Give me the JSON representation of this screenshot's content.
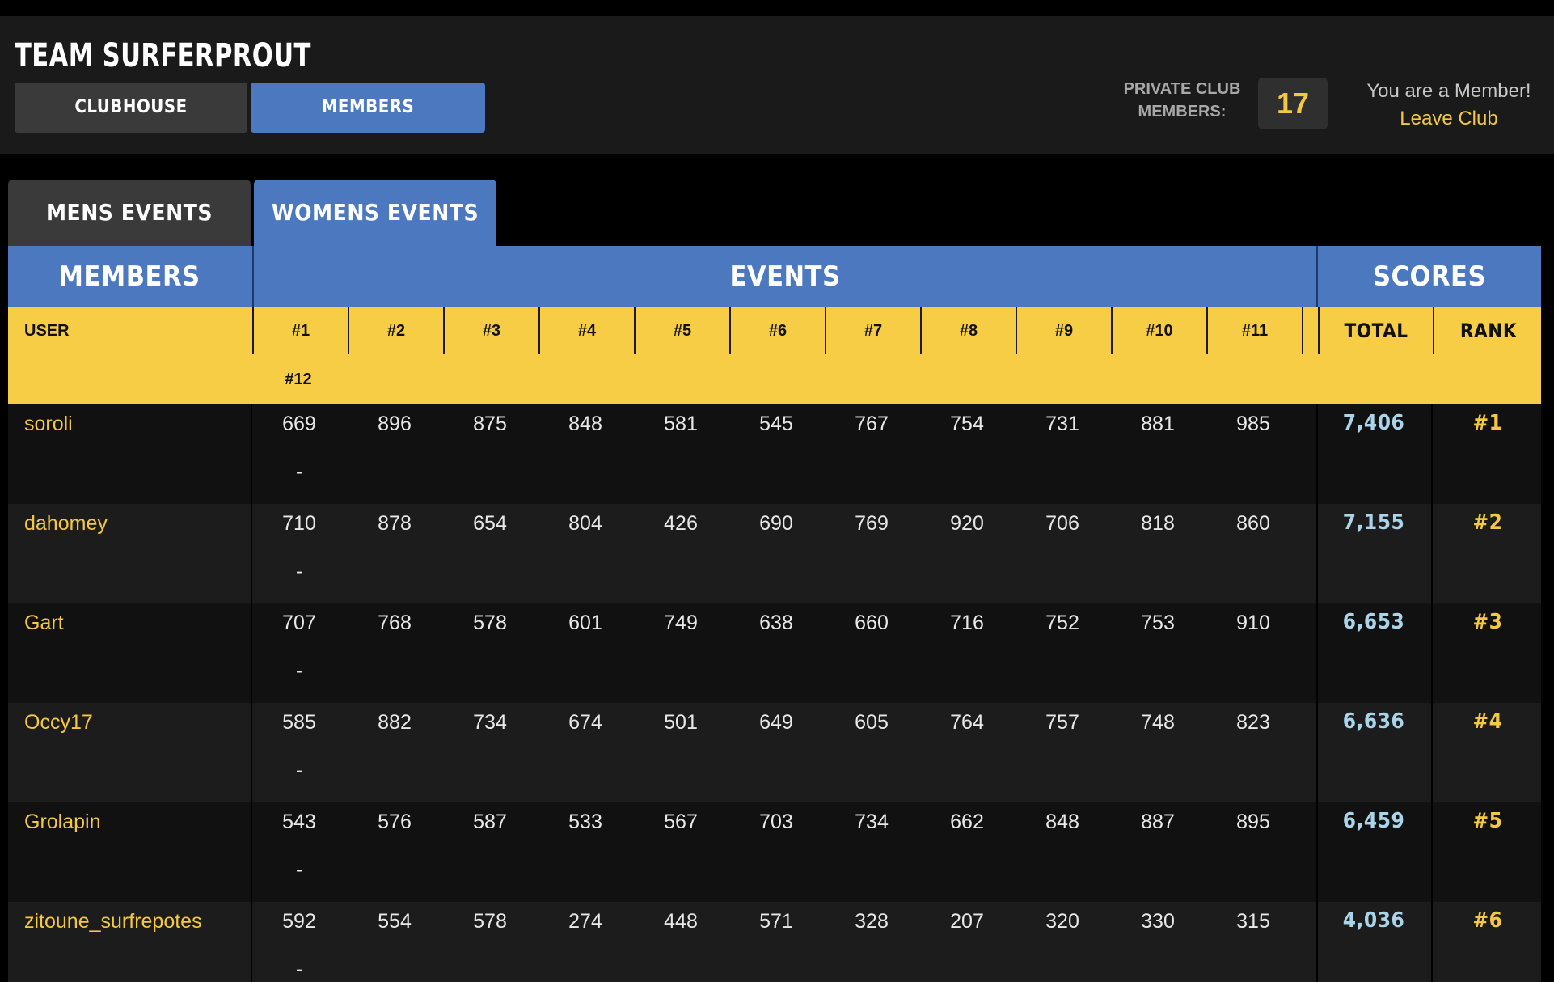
{
  "header": {
    "team_title": "TEAM SURFERPROUT",
    "nav": [
      "CLUBHOUSE",
      "MEMBERS"
    ],
    "club_label_line1": "PRIVATE CLUB",
    "club_label_line2": "MEMBERS:",
    "member_count": "17",
    "member_status": "You are a Member!",
    "leave_club": "Leave Club"
  },
  "tabs": [
    "MENS EVENTS",
    "WOMENS EVENTS"
  ],
  "table": {
    "group_headers": {
      "members": "MEMBERS",
      "events": "EVENTS",
      "scores": "SCORES"
    },
    "columns": {
      "user": "USER",
      "events": [
        "#1",
        "#2",
        "#3",
        "#4",
        "#5",
        "#6",
        "#7",
        "#8",
        "#9",
        "#10",
        "#11",
        "#12"
      ],
      "total": "TOTAL",
      "rank": "RANK"
    },
    "rows": [
      {
        "user": "soroli",
        "scores": [
          "669",
          "896",
          "875",
          "848",
          "581",
          "545",
          "767",
          "754",
          "731",
          "881",
          "985",
          "-"
        ],
        "total": "7,406",
        "rank": "#1"
      },
      {
        "user": "dahomey",
        "scores": [
          "710",
          "878",
          "654",
          "804",
          "426",
          "690",
          "769",
          "920",
          "706",
          "818",
          "860",
          "-"
        ],
        "total": "7,155",
        "rank": "#2"
      },
      {
        "user": "Gart",
        "scores": [
          "707",
          "768",
          "578",
          "601",
          "749",
          "638",
          "660",
          "716",
          "752",
          "753",
          "910",
          "-"
        ],
        "total": "6,653",
        "rank": "#3"
      },
      {
        "user": "Occy17",
        "scores": [
          "585",
          "882",
          "734",
          "674",
          "501",
          "649",
          "605",
          "764",
          "757",
          "748",
          "823",
          "-"
        ],
        "total": "6,636",
        "rank": "#4"
      },
      {
        "user": "Grolapin",
        "scores": [
          "543",
          "576",
          "587",
          "533",
          "567",
          "703",
          "734",
          "662",
          "848",
          "887",
          "895",
          "-"
        ],
        "total": "6,459",
        "rank": "#5"
      },
      {
        "user": "zitoune_surfrepotes",
        "scores": [
          "592",
          "554",
          "578",
          "274",
          "448",
          "571",
          "328",
          "207",
          "320",
          "330",
          "315",
          "-"
        ],
        "total": "4,036",
        "rank": "#6"
      }
    ]
  },
  "colors": {
    "accent_blue": "#4b78be",
    "header_yellow": "#f6cd45",
    "link_yellow": "#f5c842",
    "total_blue": "#a9d4ea"
  }
}
